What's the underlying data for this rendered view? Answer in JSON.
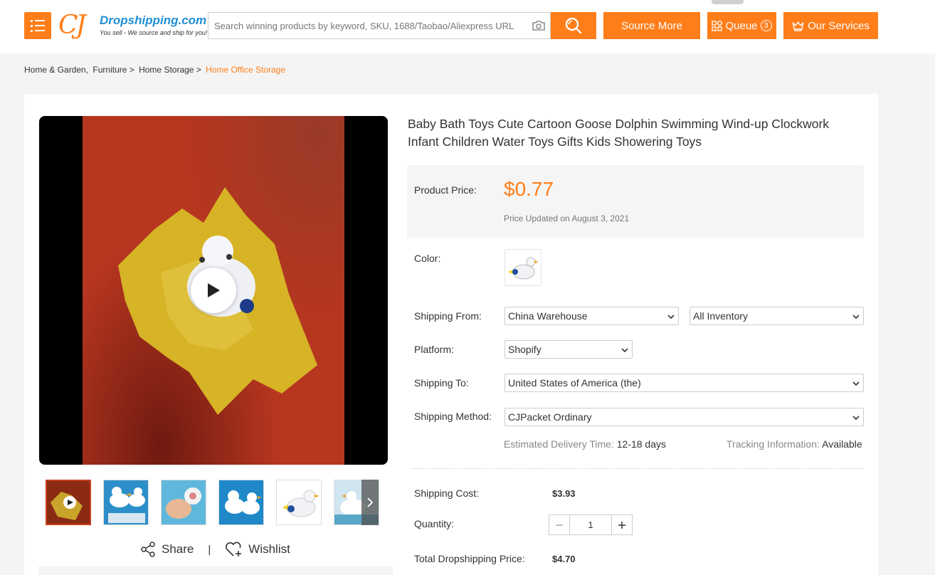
{
  "header": {
    "logo": {
      "mark": "CJ",
      "name": "Dropshipping.com",
      "tagline": "You sell - We source and ship for you!"
    },
    "search": {
      "placeholder": "Search winning products by keyword, SKU, 1688/Taobao/Aliexpress URL",
      "value": ""
    },
    "source_more_label": "Source More",
    "queue_label": "Queue",
    "queue_count": "3",
    "services_label": "Our Services"
  },
  "breadcrumb": {
    "items": [
      "Home & Garden,",
      "Furniture >",
      "Home Storage >"
    ],
    "current": "Home Office Storage"
  },
  "product": {
    "title": "Baby Bath Toys Cute Cartoon Goose Dolphin Swimming Wind-up Clockwork Infant Children Water Toys Gifts Kids Showering Toys",
    "price_label": "Product Price:",
    "price": "$0.77",
    "price_updated": "Price Updated on August 3, 2021",
    "color_label": "Color:",
    "shipping_from_label": "Shipping From:",
    "shipping_from": "China Warehouse",
    "inventory": "All Inventory",
    "platform_label": "Platform:",
    "platform": "Shopify",
    "shipping_to_label": "Shipping To:",
    "shipping_to": "United States of America (the)",
    "shipping_method_label": "Shipping Method:",
    "shipping_method": "CJPacket Ordinary",
    "delivery_label": "Estimated Delivery Time:",
    "delivery_value": "12-18 days",
    "tracking_label": "Tracking Information:",
    "tracking_value": "Available",
    "shipping_cost_label": "Shipping Cost:",
    "shipping_cost": "$3.93",
    "quantity_label": "Quantity:",
    "quantity": "1",
    "total_label": "Total Dropshipping Price:",
    "total": "$4.70"
  },
  "gallery": {
    "share_label": "Share",
    "separator": "|",
    "wishlist_label": "Wishlist"
  },
  "colors": {
    "accent": "#ff7e1a",
    "logo_blue": "#1f8fd6"
  }
}
